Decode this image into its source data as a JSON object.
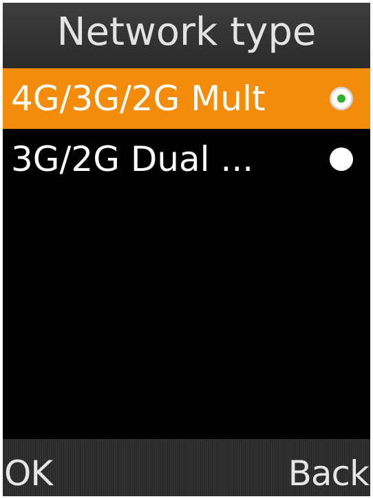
{
  "header": {
    "title": "Network type"
  },
  "network_options": [
    {
      "label": "4G/3G/2G Mult",
      "selected": true
    },
    {
      "label": "3G/2G Dual ...",
      "selected": false
    }
  ],
  "softkeys": {
    "left_label": "OK",
    "right_label": "Back"
  },
  "colors": {
    "highlight": "#f28c0a",
    "background": "#000000",
    "radio_selected_dot": "#2fae2f"
  }
}
